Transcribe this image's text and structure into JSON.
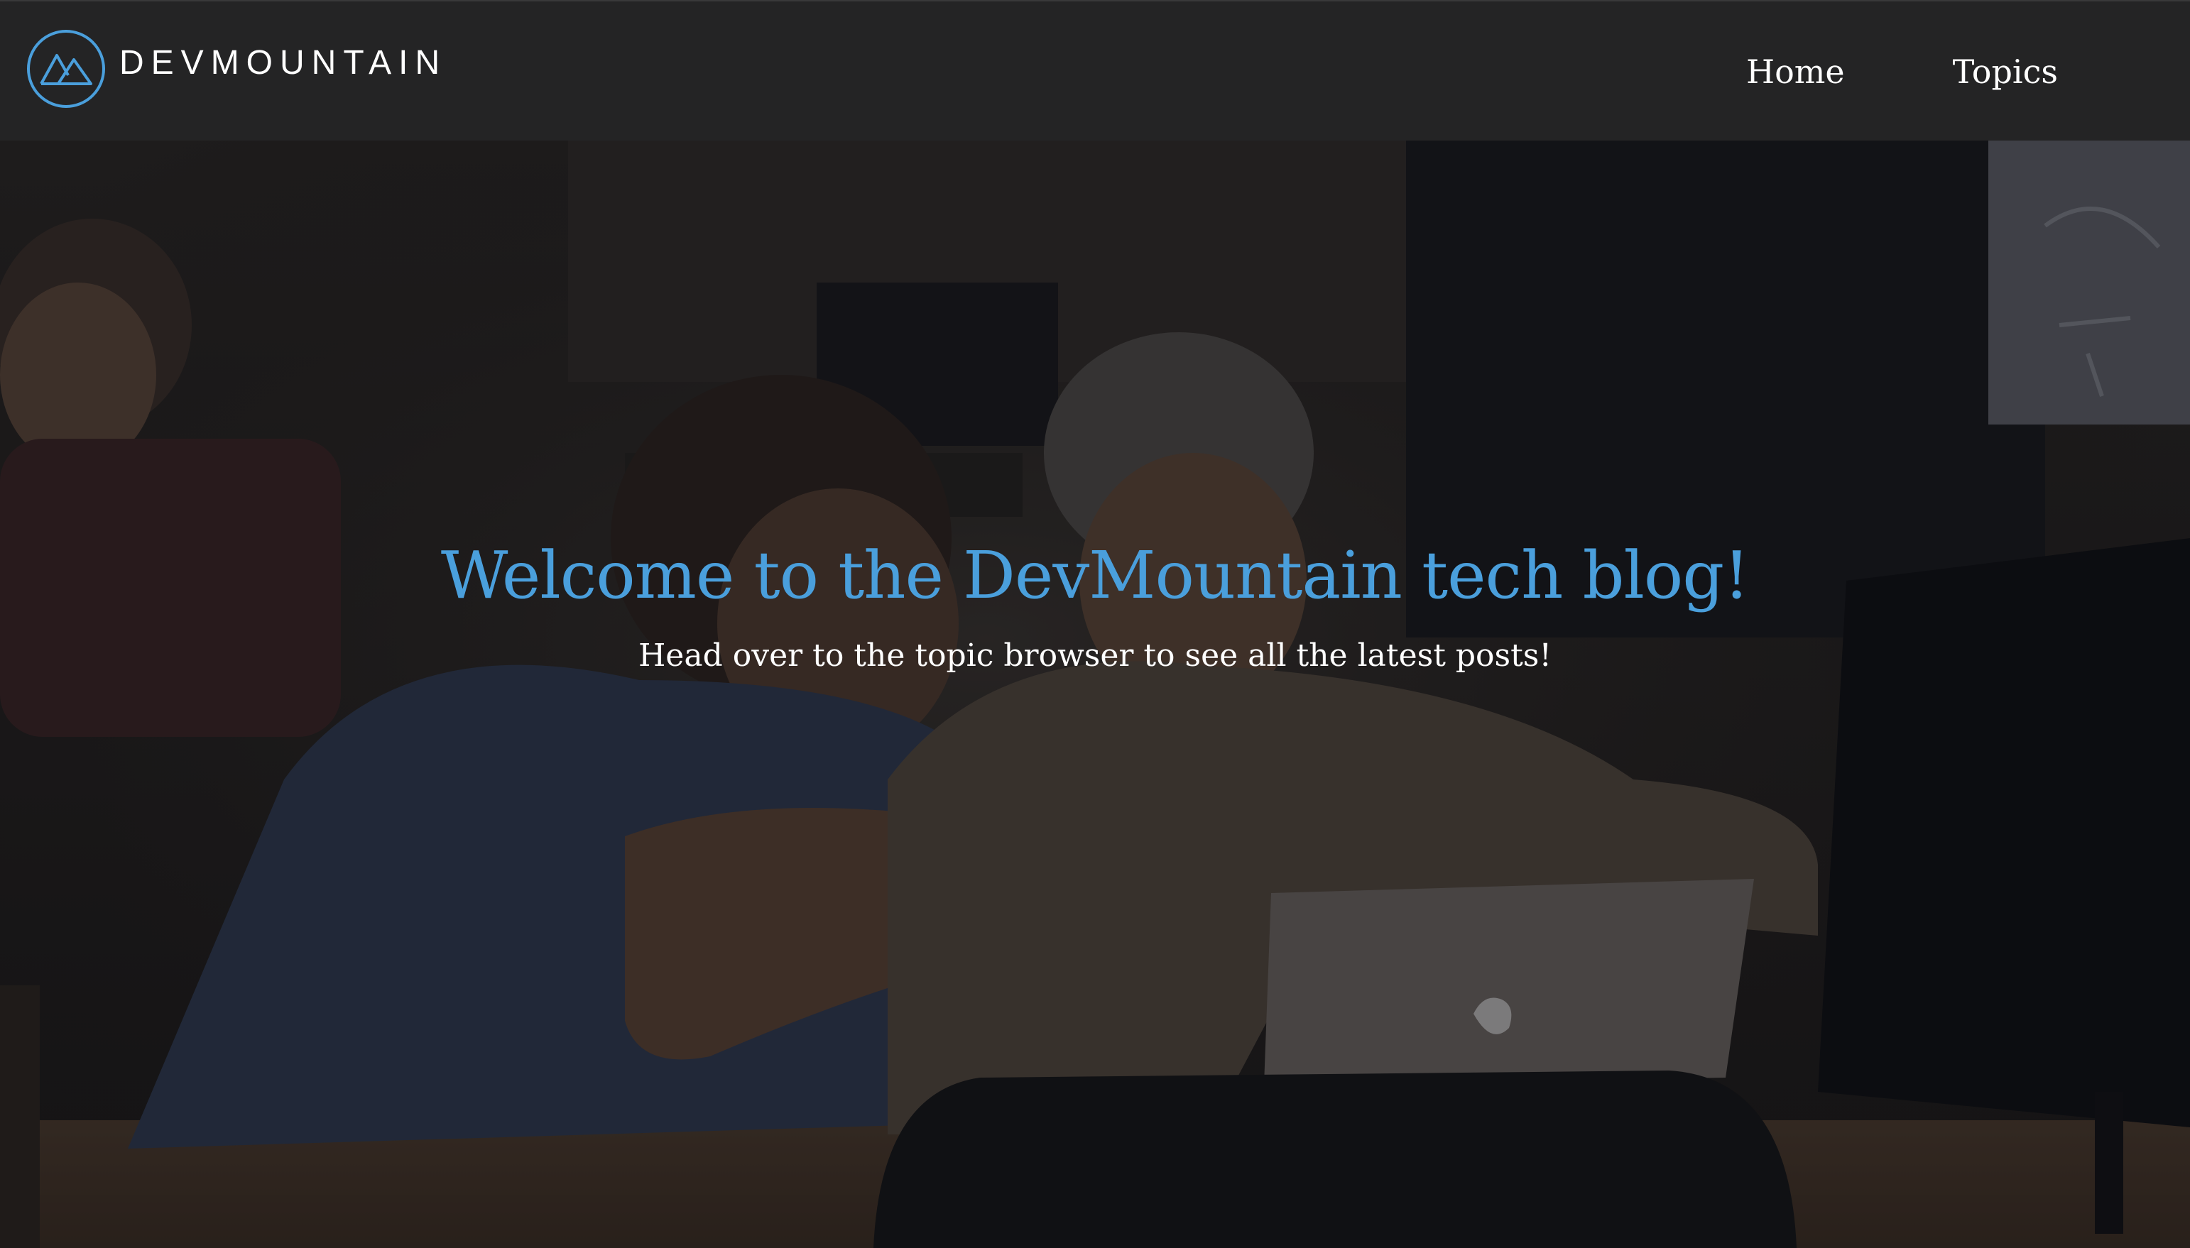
{
  "brand": {
    "name": "DEVMOUNTAIN",
    "logo_icon": "mountain-logo-icon",
    "accent_color": "#4a9fdc"
  },
  "nav": {
    "links": [
      {
        "label": "Home"
      },
      {
        "label": "Topics"
      }
    ]
  },
  "hero": {
    "title": "Welcome to the DevMountain tech blog!",
    "subtitle": "Head over to the topic browser to see all the latest posts!",
    "title_color": "#4a9fdc",
    "background": "darkened photo of students working at laptops"
  }
}
